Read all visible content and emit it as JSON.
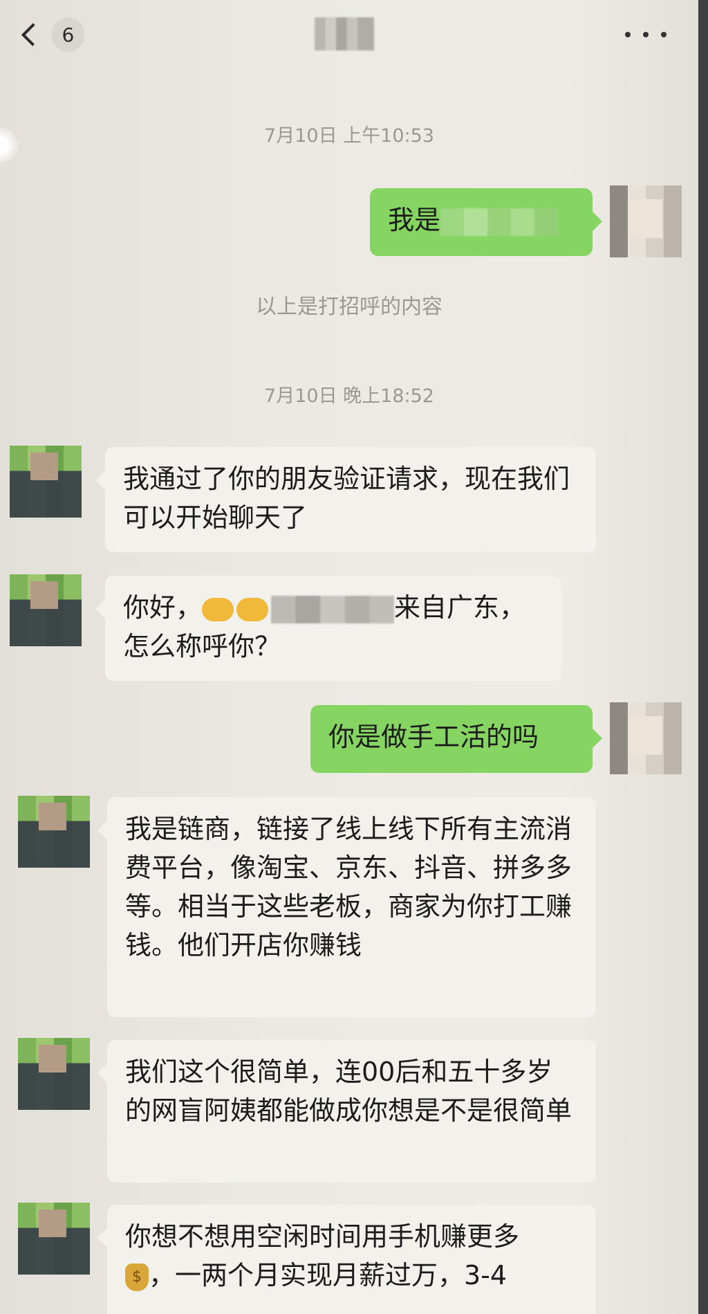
{
  "header": {
    "unread_count": "6"
  },
  "timestamps": [
    "7月10日 上午10:53",
    "7月10日 晚上18:52"
  ],
  "system_note": "以上是打招呼的内容",
  "messages": [
    {
      "side": "out",
      "text": "我是"
    },
    {
      "side": "in",
      "text": "我通过了你的朋友验证请求，现在我们可以开始聊天了"
    },
    {
      "side": "in",
      "text_a": "你好，",
      "text_b": "来自广东，",
      "text_c": "怎么称呼你？"
    },
    {
      "side": "out",
      "text": "你是做手工活的吗"
    },
    {
      "side": "in",
      "text": "我是链商，链接了线上线下所有主流消费平台，像淘宝、京东、抖音、拼多多等。相当于这些老板，商家为你打工赚钱。他们开店你赚钱"
    },
    {
      "side": "in",
      "text": "我们这个很简单，连00后和五十多岁的网盲阿姨都能做成你想是不是很简单"
    },
    {
      "side": "in",
      "text_a": "你想不想用空闲时间用手机赚更多",
      "text_b": "，一两个月实现月薪过万，3-4"
    }
  ],
  "colors": {
    "outgoing_bubble": "#86d563",
    "incoming_bubble": "#f3f1ec",
    "background": "#eceae4"
  },
  "icons": [
    "back-chevron-icon",
    "more-dots-icon",
    "handshake-emoji-icon",
    "money-bag-emoji-icon"
  ]
}
